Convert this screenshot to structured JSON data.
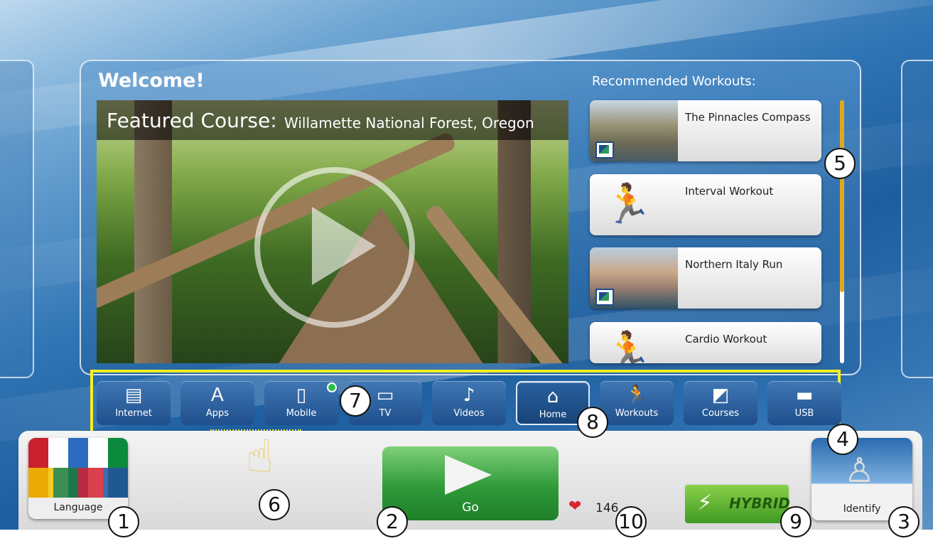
{
  "welcome": "Welcome!",
  "featured": {
    "label": "Featured Course:",
    "name": "Willamette National Forest, Oregon"
  },
  "recommended": {
    "title": "Recommended Workouts:",
    "items": [
      {
        "label": "The Pinnacles Compass",
        "thumb": "course-photo"
      },
      {
        "label": "Interval Workout",
        "thumb": "runner-icon"
      },
      {
        "label": "Northern Italy Run",
        "thumb": "course-photo"
      },
      {
        "label": "Cardio Workout",
        "thumb": "runner-icon"
      }
    ],
    "scroll_fraction": 0.73
  },
  "nav": {
    "items": [
      {
        "label": "Internet",
        "icon": "internet-icon"
      },
      {
        "label": "Apps",
        "icon": "apps-icon"
      },
      {
        "label": "Mobile",
        "icon": "mobile-icon"
      },
      {
        "label": "TV",
        "icon": "tv-icon"
      },
      {
        "label": "Videos",
        "icon": "videos-icon"
      },
      {
        "label": "Home",
        "icon": "home-icon"
      },
      {
        "label": "Workouts",
        "icon": "workouts-icon"
      },
      {
        "label": "Courses",
        "icon": "courses-icon"
      },
      {
        "label": "USB",
        "icon": "usb-icon"
      }
    ],
    "active": "Home"
  },
  "bottom": {
    "language_label": "Language",
    "go_label": "Go",
    "heart_rate": "146",
    "hybrid_label": "HYBRID",
    "identify_label": "Identify"
  },
  "callouts": [
    "1",
    "2",
    "3",
    "4",
    "5",
    "6",
    "7",
    "8",
    "9",
    "10"
  ],
  "colors": {
    "highlight": "#f7f01c",
    "scroll_thumb": "#e0a820",
    "go_green": "#2f9a38",
    "heart_red": "#d8262e"
  }
}
